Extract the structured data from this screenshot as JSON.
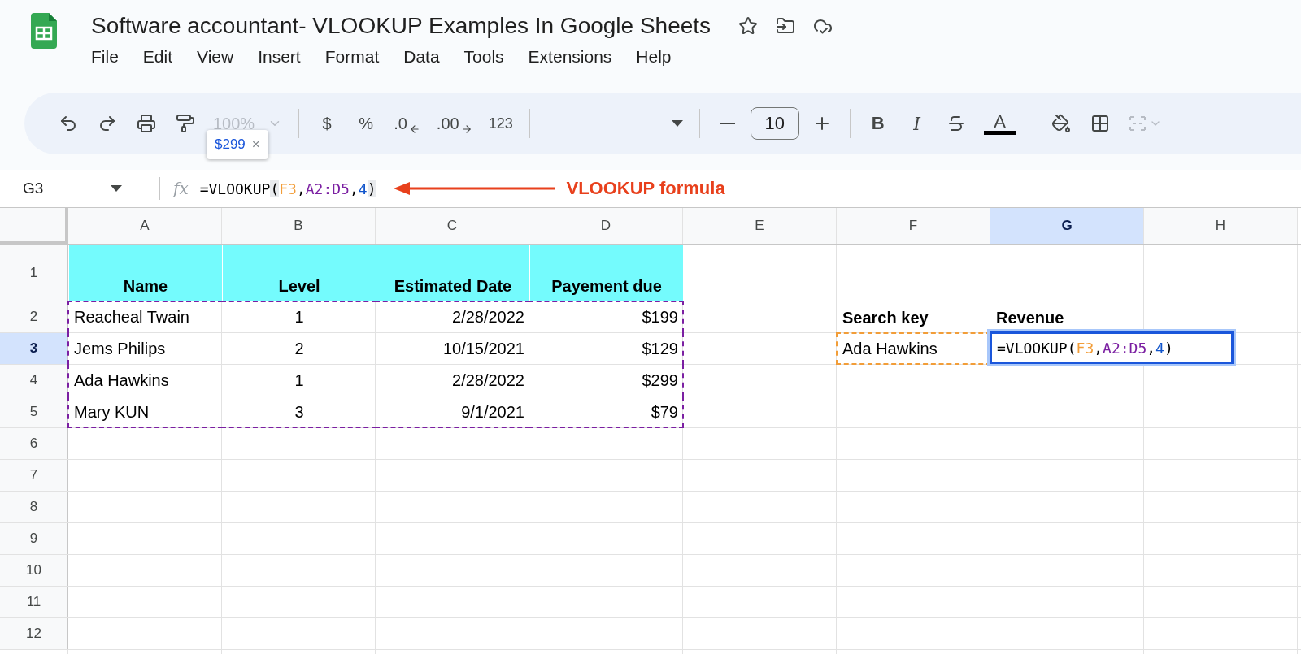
{
  "document": {
    "title": "Software accountant- VLOOKUP Examples In Google Sheets",
    "menu": [
      "File",
      "Edit",
      "View",
      "Insert",
      "Format",
      "Data",
      "Tools",
      "Extensions",
      "Help"
    ]
  },
  "toolbar": {
    "zoom": "100%",
    "currency": "$",
    "percent": "%",
    "decrease_decimals": ".0",
    "increase_decimals": ".00",
    "more_formats": "123",
    "font_size": "10",
    "bold": "B",
    "italic": "I",
    "text_color": "A"
  },
  "tooltip": {
    "value": "$299",
    "close": "×"
  },
  "formula_bar": {
    "name_box": "G3",
    "fx": "fx",
    "formula": [
      {
        "text": "=VLOOKUP",
        "color": "#000000",
        "matched": false
      },
      {
        "text": "(",
        "color": "#000000",
        "matched": true
      },
      {
        "text": "F3",
        "color": "#f29d38",
        "matched": false
      },
      {
        "text": ",",
        "color": "#000000",
        "matched": false
      },
      {
        "text": "A2:D5",
        "color": "#7b1fa2",
        "matched": false
      },
      {
        "text": ",",
        "color": "#000000",
        "matched": false
      },
      {
        "text": "4",
        "color": "#1155cc",
        "matched": false
      },
      {
        "text": ")",
        "color": "#000000",
        "matched": true
      }
    ]
  },
  "annotation": {
    "text": "VLOOKUP formula"
  },
  "sheet": {
    "columns": [
      {
        "label": "A",
        "selected": false
      },
      {
        "label": "B",
        "selected": false
      },
      {
        "label": "C",
        "selected": false
      },
      {
        "label": "D",
        "selected": false
      },
      {
        "label": "E",
        "selected": false
      },
      {
        "label": "F",
        "selected": false
      },
      {
        "label": "G",
        "selected": true
      },
      {
        "label": "H",
        "selected": false
      }
    ],
    "rows": [
      {
        "label": "1",
        "selected": false,
        "cells": [
          {
            "kind": "header",
            "text": "Name"
          },
          {
            "kind": "header",
            "text": "Level"
          },
          {
            "kind": "header",
            "text": "Estimated Date"
          },
          {
            "kind": "header",
            "text": "Payement due"
          }
        ]
      },
      {
        "label": "2",
        "selected": false,
        "cells": [
          {
            "kind": "text",
            "text": "Reacheal Twain",
            "color": "#7b1fa2"
          },
          {
            "kind": "center",
            "text": "1",
            "color": "#7b1fa2"
          },
          {
            "kind": "number",
            "text": "2/28/2022",
            "color": "#7b1fa2"
          },
          {
            "kind": "number",
            "text": "$199",
            "color": "#7b1fa2"
          },
          {},
          {
            "kind": "label",
            "text": "Search key"
          },
          {
            "kind": "label",
            "text": "Revenue"
          }
        ]
      },
      {
        "label": "3",
        "selected": true,
        "cells": [
          {
            "kind": "text",
            "text": "Jems Philips",
            "color": "#7b1fa2"
          },
          {
            "kind": "center",
            "text": "2"
          },
          {
            "kind": "number",
            "text": "10/15/2021"
          },
          {
            "kind": "number",
            "text": "$129",
            "color": "#7b1fa2"
          },
          {},
          {
            "kind": "text",
            "text": "Ada Hawkins",
            "color": "#f29d38"
          },
          {
            "kind": "formula",
            "formula": [
              {
                "text": "=VLOOKUP(",
                "color": "#000000"
              },
              {
                "text": "F3",
                "color": "#f29d38"
              },
              {
                "text": ",",
                "color": "#000000"
              },
              {
                "text": "A2:D5",
                "color": "#7b1fa2"
              },
              {
                "text": ",",
                "color": "#000000"
              },
              {
                "text": "4",
                "color": "#1155cc"
              },
              {
                "text": ")",
                "color": "#000000"
              }
            ]
          }
        ]
      },
      {
        "label": "4",
        "selected": false,
        "cells": [
          {
            "kind": "text",
            "text": "Ada Hawkins",
            "color": "#7b1fa2"
          },
          {
            "kind": "center",
            "text": "1"
          },
          {
            "kind": "number",
            "text": "2/28/2022"
          },
          {
            "kind": "number",
            "text": "$299",
            "color": "#7b1fa2"
          }
        ]
      },
      {
        "label": "5",
        "selected": false,
        "cells": [
          {
            "kind": "text",
            "text": "Mary KUN",
            "color": "#7b1fa2"
          },
          {
            "kind": "center",
            "text": "3",
            "color": "#7b1fa2"
          },
          {
            "kind": "number",
            "text": "9/1/2021",
            "color": "#7b1fa2"
          },
          {
            "kind": "number",
            "text": "$79",
            "color": "#7b1fa2"
          }
        ]
      },
      {
        "label": "6",
        "selected": false
      },
      {
        "label": "7",
        "selected": false
      },
      {
        "label": "8",
        "selected": false
      },
      {
        "label": "9",
        "selected": false
      },
      {
        "label": "10",
        "selected": false
      },
      {
        "label": "11",
        "selected": false
      },
      {
        "label": "12",
        "selected": false
      }
    ]
  }
}
